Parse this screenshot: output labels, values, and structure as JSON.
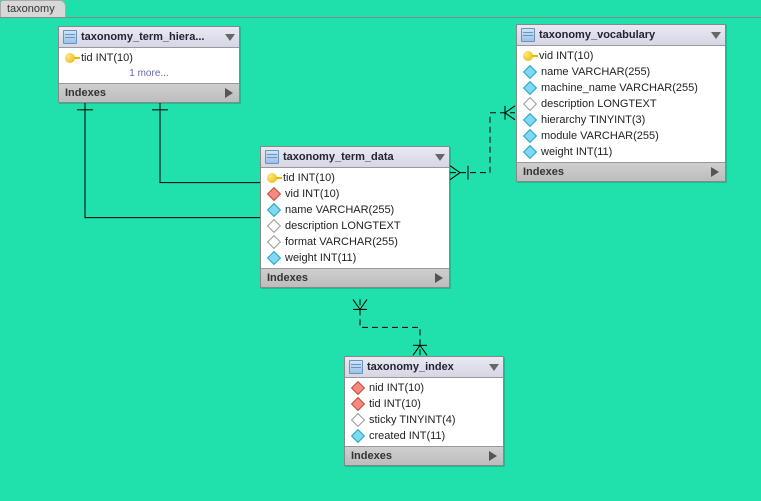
{
  "tab_label": "taxonomy",
  "indexes_label": "Indexes",
  "more_label": "1 more...",
  "entities": {
    "hierarchy": {
      "title": "taxonomy_term_hiera...",
      "columns": [
        {
          "icon": "key",
          "text": "tid INT(10)"
        }
      ],
      "has_more": true
    },
    "term_data": {
      "title": "taxonomy_term_data",
      "columns": [
        {
          "icon": "key",
          "text": "tid INT(10)"
        },
        {
          "icon": "d-red",
          "text": "vid INT(10)"
        },
        {
          "icon": "d-cyan",
          "text": "name VARCHAR(255)"
        },
        {
          "icon": "d-white",
          "text": "description LONGTEXT"
        },
        {
          "icon": "d-white",
          "text": "format VARCHAR(255)"
        },
        {
          "icon": "d-cyan",
          "text": "weight INT(11)"
        }
      ]
    },
    "vocabulary": {
      "title": "taxonomy_vocabulary",
      "columns": [
        {
          "icon": "key",
          "text": "vid INT(10)"
        },
        {
          "icon": "d-cyan",
          "text": "name VARCHAR(255)"
        },
        {
          "icon": "d-cyan",
          "text": "machine_name VARCHAR(255)"
        },
        {
          "icon": "d-white",
          "text": "description LONGTEXT"
        },
        {
          "icon": "d-cyan",
          "text": "hierarchy TINYINT(3)"
        },
        {
          "icon": "d-cyan",
          "text": "module VARCHAR(255)"
        },
        {
          "icon": "d-cyan",
          "text": "weight INT(11)"
        }
      ]
    },
    "index": {
      "title": "taxonomy_index",
      "columns": [
        {
          "icon": "d-red",
          "text": "nid INT(10)"
        },
        {
          "icon": "d-red",
          "text": "tid INT(10)"
        },
        {
          "icon": "d-white",
          "text": "sticky TINYINT(4)"
        },
        {
          "icon": "d-cyan",
          "text": "created INT(11)"
        }
      ]
    }
  }
}
